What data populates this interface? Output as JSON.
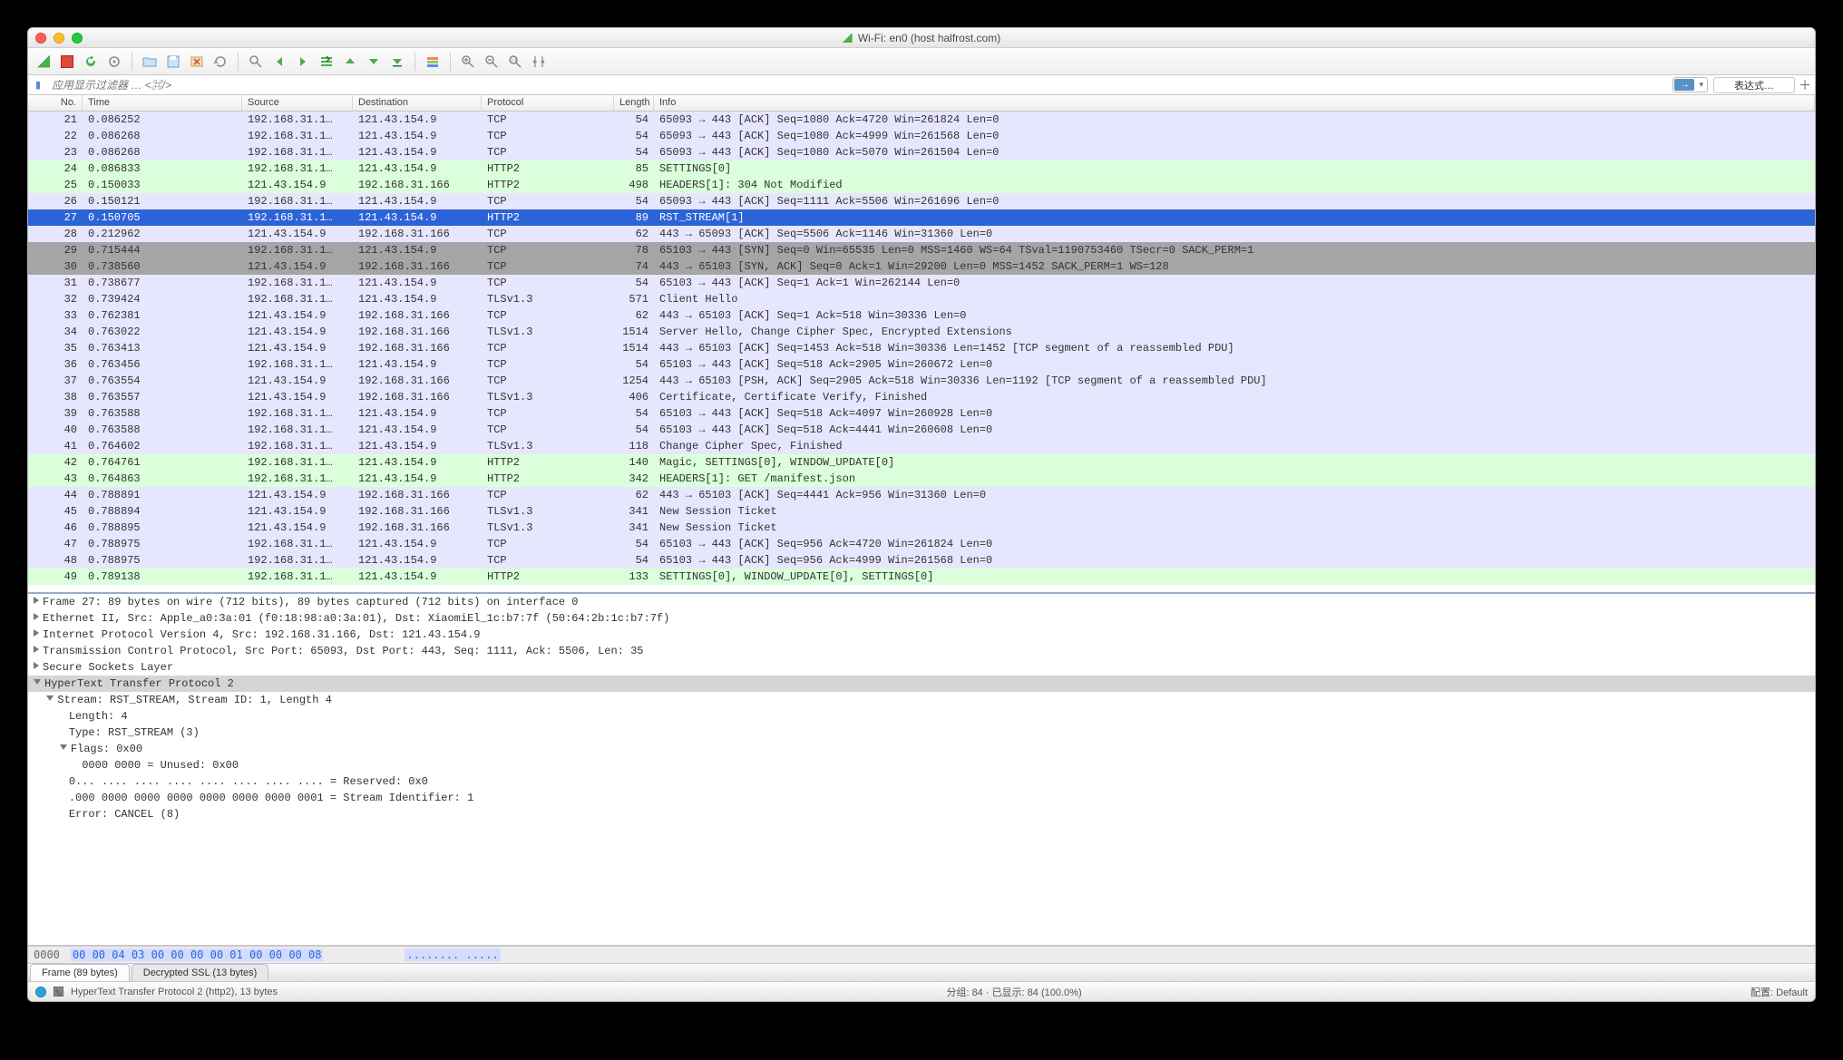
{
  "title": "Wi-Fi: en0 (host halfrost.com)",
  "filter_placeholder": "应用显示过滤器 … <⌘/>",
  "expression_label": "表达式…",
  "columns": {
    "no": "No.",
    "time": "Time",
    "src": "Source",
    "dst": "Destination",
    "proto": "Protocol",
    "len": "Length",
    "info": "Info"
  },
  "packets": [
    {
      "no": "21",
      "time": "0.086252",
      "src": "192.168.31.1…",
      "dst": "121.43.154.9",
      "proto": "TCP",
      "len": "54",
      "info": "65093 → 443 [ACK] Seq=1080 Ack=4720 Win=261824 Len=0",
      "cls": "bg-lav"
    },
    {
      "no": "22",
      "time": "0.086268",
      "src": "192.168.31.1…",
      "dst": "121.43.154.9",
      "proto": "TCP",
      "len": "54",
      "info": "65093 → 443 [ACK] Seq=1080 Ack=4999 Win=261568 Len=0",
      "cls": "bg-lav"
    },
    {
      "no": "23",
      "time": "0.086268",
      "src": "192.168.31.1…",
      "dst": "121.43.154.9",
      "proto": "TCP",
      "len": "54",
      "info": "65093 → 443 [ACK] Seq=1080 Ack=5070 Win=261504 Len=0",
      "cls": "bg-lav"
    },
    {
      "no": "24",
      "time": "0.086833",
      "src": "192.168.31.1…",
      "dst": "121.43.154.9",
      "proto": "HTTP2",
      "len": "85",
      "info": "SETTINGS[0]",
      "cls": "bg-grn"
    },
    {
      "no": "25",
      "time": "0.150033",
      "src": "121.43.154.9",
      "dst": "192.168.31.166",
      "proto": "HTTP2",
      "len": "498",
      "info": "HEADERS[1]: 304 Not Modified",
      "cls": "bg-grn"
    },
    {
      "no": "26",
      "time": "0.150121",
      "src": "192.168.31.1…",
      "dst": "121.43.154.9",
      "proto": "TCP",
      "len": "54",
      "info": "65093 → 443 [ACK] Seq=1111 Ack=5506 Win=261696 Len=0",
      "cls": "bg-lav"
    },
    {
      "no": "27",
      "time": "0.150705",
      "src": "192.168.31.1…",
      "dst": "121.43.154.9",
      "proto": "HTTP2",
      "len": "89",
      "info": "RST_STREAM[1]",
      "cls": "bg-sel"
    },
    {
      "no": "28",
      "time": "0.212962",
      "src": "121.43.154.9",
      "dst": "192.168.31.166",
      "proto": "TCP",
      "len": "62",
      "info": "443 → 65093 [ACK] Seq=5506 Ack=1146 Win=31360 Len=0",
      "cls": "bg-lav"
    },
    {
      "no": "29",
      "time": "0.715444",
      "src": "192.168.31.1…",
      "dst": "121.43.154.9",
      "proto": "TCP",
      "len": "78",
      "info": "65103 → 443 [SYN] Seq=0 Win=65535 Len=0 MSS=1460 WS=64 TSval=1190753460 TSecr=0 SACK_PERM=1",
      "cls": "bg-gray"
    },
    {
      "no": "30",
      "time": "0.738560",
      "src": "121.43.154.9",
      "dst": "192.168.31.166",
      "proto": "TCP",
      "len": "74",
      "info": "443 → 65103 [SYN, ACK] Seq=0 Ack=1 Win=29200 Len=0 MSS=1452 SACK_PERM=1 WS=128",
      "cls": "bg-gray"
    },
    {
      "no": "31",
      "time": "0.738677",
      "src": "192.168.31.1…",
      "dst": "121.43.154.9",
      "proto": "TCP",
      "len": "54",
      "info": "65103 → 443 [ACK] Seq=1 Ack=1 Win=262144 Len=0",
      "cls": "bg-lav"
    },
    {
      "no": "32",
      "time": "0.739424",
      "src": "192.168.31.1…",
      "dst": "121.43.154.9",
      "proto": "TLSv1.3",
      "len": "571",
      "info": "Client Hello",
      "cls": "bg-lav"
    },
    {
      "no": "33",
      "time": "0.762381",
      "src": "121.43.154.9",
      "dst": "192.168.31.166",
      "proto": "TCP",
      "len": "62",
      "info": "443 → 65103 [ACK] Seq=1 Ack=518 Win=30336 Len=0",
      "cls": "bg-lav"
    },
    {
      "no": "34",
      "time": "0.763022",
      "src": "121.43.154.9",
      "dst": "192.168.31.166",
      "proto": "TLSv1.3",
      "len": "1514",
      "info": "Server Hello, Change Cipher Spec, Encrypted Extensions",
      "cls": "bg-lav"
    },
    {
      "no": "35",
      "time": "0.763413",
      "src": "121.43.154.9",
      "dst": "192.168.31.166",
      "proto": "TCP",
      "len": "1514",
      "info": "443 → 65103 [ACK] Seq=1453 Ack=518 Win=30336 Len=1452 [TCP segment of a reassembled PDU]",
      "cls": "bg-lav"
    },
    {
      "no": "36",
      "time": "0.763456",
      "src": "192.168.31.1…",
      "dst": "121.43.154.9",
      "proto": "TCP",
      "len": "54",
      "info": "65103 → 443 [ACK] Seq=518 Ack=2905 Win=260672 Len=0",
      "cls": "bg-lav"
    },
    {
      "no": "37",
      "time": "0.763554",
      "src": "121.43.154.9",
      "dst": "192.168.31.166",
      "proto": "TCP",
      "len": "1254",
      "info": "443 → 65103 [PSH, ACK] Seq=2905 Ack=518 Win=30336 Len=1192 [TCP segment of a reassembled PDU]",
      "cls": "bg-lav"
    },
    {
      "no": "38",
      "time": "0.763557",
      "src": "121.43.154.9",
      "dst": "192.168.31.166",
      "proto": "TLSv1.3",
      "len": "406",
      "info": "Certificate, Certificate Verify, Finished",
      "cls": "bg-lav"
    },
    {
      "no": "39",
      "time": "0.763588",
      "src": "192.168.31.1…",
      "dst": "121.43.154.9",
      "proto": "TCP",
      "len": "54",
      "info": "65103 → 443 [ACK] Seq=518 Ack=4097 Win=260928 Len=0",
      "cls": "bg-lav"
    },
    {
      "no": "40",
      "time": "0.763588",
      "src": "192.168.31.1…",
      "dst": "121.43.154.9",
      "proto": "TCP",
      "len": "54",
      "info": "65103 → 443 [ACK] Seq=518 Ack=4441 Win=260608 Len=0",
      "cls": "bg-lav"
    },
    {
      "no": "41",
      "time": "0.764602",
      "src": "192.168.31.1…",
      "dst": "121.43.154.9",
      "proto": "TLSv1.3",
      "len": "118",
      "info": "Change Cipher Spec, Finished",
      "cls": "bg-lav"
    },
    {
      "no": "42",
      "time": "0.764761",
      "src": "192.168.31.1…",
      "dst": "121.43.154.9",
      "proto": "HTTP2",
      "len": "140",
      "info": "Magic, SETTINGS[0], WINDOW_UPDATE[0]",
      "cls": "bg-grn"
    },
    {
      "no": "43",
      "time": "0.764863",
      "src": "192.168.31.1…",
      "dst": "121.43.154.9",
      "proto": "HTTP2",
      "len": "342",
      "info": "HEADERS[1]: GET /manifest.json",
      "cls": "bg-grn"
    },
    {
      "no": "44",
      "time": "0.788891",
      "src": "121.43.154.9",
      "dst": "192.168.31.166",
      "proto": "TCP",
      "len": "62",
      "info": "443 → 65103 [ACK] Seq=4441 Ack=956 Win=31360 Len=0",
      "cls": "bg-lav"
    },
    {
      "no": "45",
      "time": "0.788894",
      "src": "121.43.154.9",
      "dst": "192.168.31.166",
      "proto": "TLSv1.3",
      "len": "341",
      "info": "New Session Ticket",
      "cls": "bg-lav"
    },
    {
      "no": "46",
      "time": "0.788895",
      "src": "121.43.154.9",
      "dst": "192.168.31.166",
      "proto": "TLSv1.3",
      "len": "341",
      "info": "New Session Ticket",
      "cls": "bg-lav"
    },
    {
      "no": "47",
      "time": "0.788975",
      "src": "192.168.31.1…",
      "dst": "121.43.154.9",
      "proto": "TCP",
      "len": "54",
      "info": "65103 → 443 [ACK] Seq=956 Ack=4720 Win=261824 Len=0",
      "cls": "bg-lav"
    },
    {
      "no": "48",
      "time": "0.788975",
      "src": "192.168.31.1…",
      "dst": "121.43.154.9",
      "proto": "TCP",
      "len": "54",
      "info": "65103 → 443 [ACK] Seq=956 Ack=4999 Win=261568 Len=0",
      "cls": "bg-lav"
    },
    {
      "no": "49",
      "time": "0.789138",
      "src": "192.168.31.1…",
      "dst": "121.43.154.9",
      "proto": "HTTP2",
      "len": "133",
      "info": "SETTINGS[0], WINDOW_UPDATE[0], SETTINGS[0]",
      "cls": "bg-grn"
    }
  ],
  "tree": [
    {
      "ind": 0,
      "exp": "r",
      "text": "Frame 27: 89 bytes on wire (712 bits), 89 bytes captured (712 bits) on interface 0"
    },
    {
      "ind": 0,
      "exp": "r",
      "text": "Ethernet II, Src: Apple_a0:3a:01 (f0:18:98:a0:3a:01), Dst: XiaomiEl_1c:b7:7f (50:64:2b:1c:b7:7f)"
    },
    {
      "ind": 0,
      "exp": "r",
      "text": "Internet Protocol Version 4, Src: 192.168.31.166, Dst: 121.43.154.9"
    },
    {
      "ind": 0,
      "exp": "r",
      "text": "Transmission Control Protocol, Src Port: 65093, Dst Port: 443, Seq: 1111, Ack: 5506, Len: 35"
    },
    {
      "ind": 0,
      "exp": "r",
      "text": "Secure Sockets Layer"
    },
    {
      "ind": 0,
      "exp": "d",
      "text": "HyperText Transfer Protocol 2",
      "hl": true
    },
    {
      "ind": 1,
      "exp": "d",
      "text": "Stream: RST_STREAM, Stream ID: 1, Length 4"
    },
    {
      "ind": 2,
      "exp": "",
      "text": "Length: 4"
    },
    {
      "ind": 2,
      "exp": "",
      "text": "Type: RST_STREAM (3)"
    },
    {
      "ind": 2,
      "exp": "d",
      "text": "Flags: 0x00"
    },
    {
      "ind": 3,
      "exp": "",
      "text": "0000 0000 = Unused: 0x00"
    },
    {
      "ind": 2,
      "exp": "",
      "text": "0... .... .... .... .... .... .... .... = Reserved: 0x0"
    },
    {
      "ind": 2,
      "exp": "",
      "text": ".000 0000 0000 0000 0000 0000 0000 0001 = Stream Identifier: 1"
    },
    {
      "ind": 2,
      "exp": "",
      "text": "Error: CANCEL (8)"
    }
  ],
  "hex": {
    "offset": "0000",
    "bytes": "00 00 04 03 00 00 00 00  01 00 00 00 08",
    "ascii": "........ ....."
  },
  "tabs": {
    "frame": "Frame (89 bytes)",
    "ssl": "Decrypted SSL (13 bytes)"
  },
  "status": {
    "left": "HyperText Transfer Protocol 2 (http2), 13 bytes",
    "center": "分组: 84 · 已显示: 84 (100.0%)",
    "right": "配置: Default"
  }
}
